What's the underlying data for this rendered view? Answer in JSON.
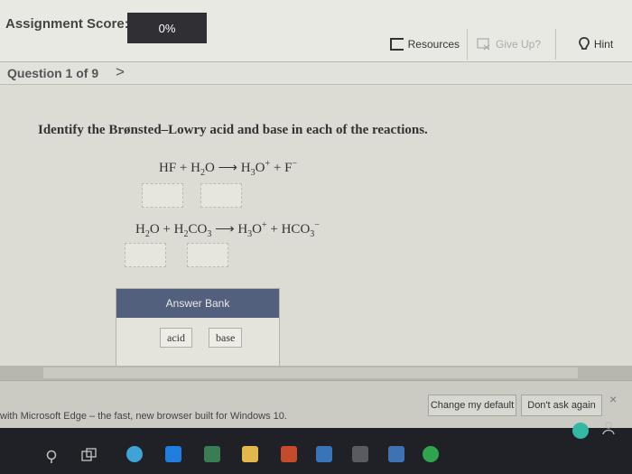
{
  "header": {
    "score_label": "Assignment Score:",
    "score_value": "0%",
    "resources_label": "Resources",
    "give_up_label": "Give Up?",
    "hint_label": "Hint"
  },
  "question_nav": {
    "label": "Question 1 of 9",
    "next_glyph": ">"
  },
  "question": {
    "prompt": "Identify the Brønsted–Lowry acid and base in each of the reactions."
  },
  "answer_bank": {
    "title": "Answer Bank",
    "items": [
      "acid",
      "base"
    ]
  },
  "notification": {
    "text": "with Microsoft Edge – the fast, new browser built for Windows 10.",
    "change_default_label": "Change my default",
    "dont_ask_label": "Don't ask again",
    "close_glyph": "×"
  },
  "colors": {
    "score_box": "#2f2f34",
    "answer_bank_header": "#53607d",
    "taskbar": "#202126"
  }
}
